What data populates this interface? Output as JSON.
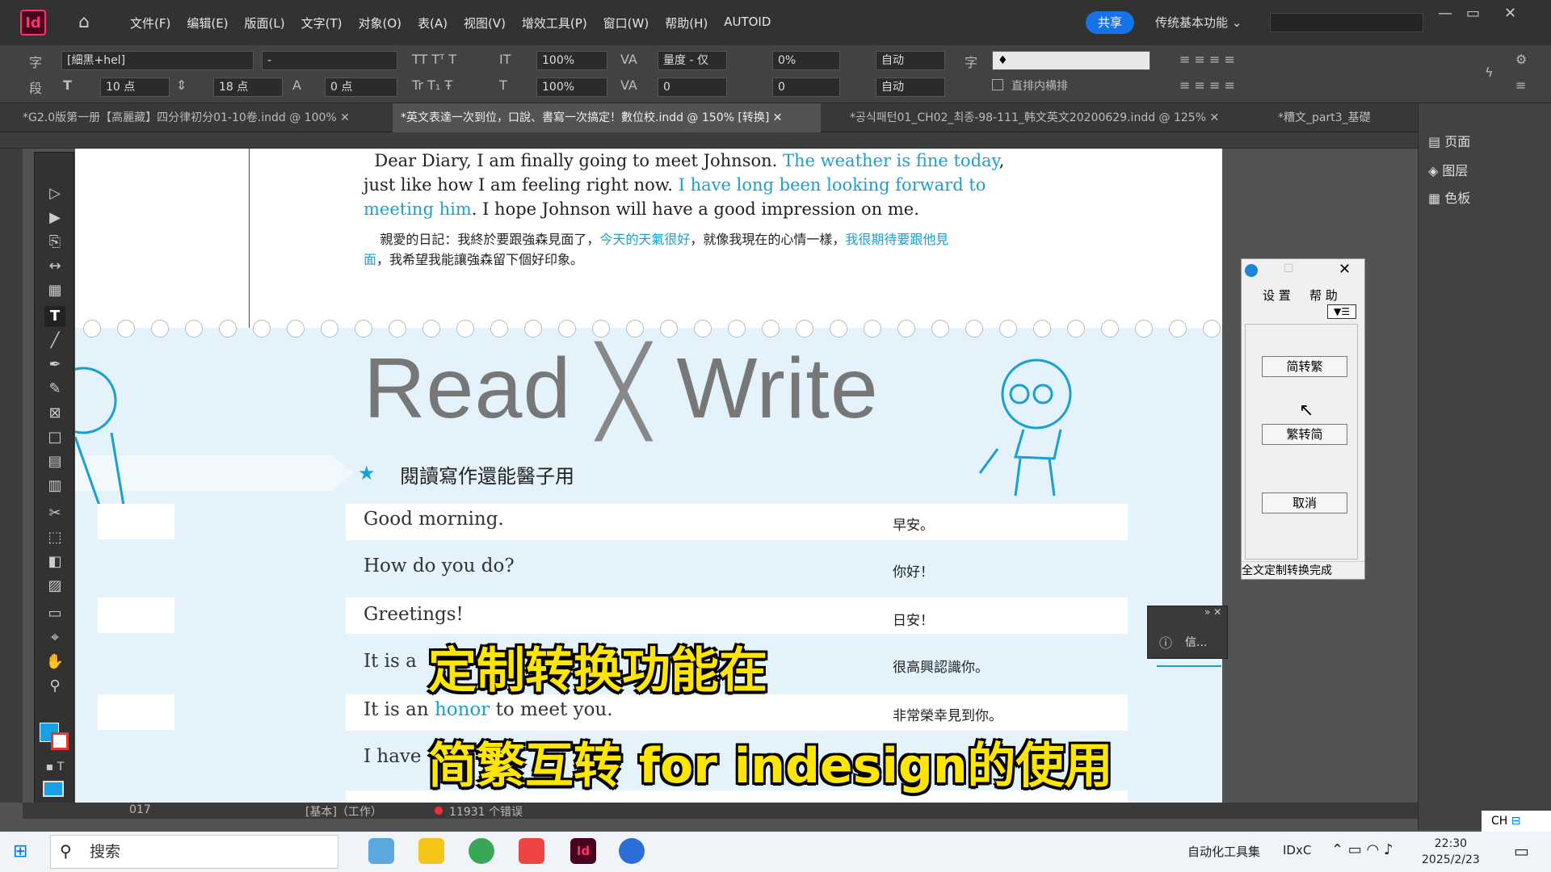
{
  "app": {
    "logo": "Id",
    "menus": [
      "文件(F)",
      "编辑(E)",
      "版面(L)",
      "文字(T)",
      "对象(O)",
      "表(A)",
      "视图(V)",
      "增效工具(P)",
      "窗口(W)",
      "帮助(H)",
      "AUTOID"
    ],
    "share": "共享",
    "workspace": "传统基本功能 ⌄"
  },
  "control": {
    "font": "[細黑+hel]",
    "style": "-",
    "size": "10 点",
    "leading": "18 点",
    "baseline": "0 点",
    "hscale": "100%",
    "vscale": "100%",
    "kerning": "量度 - 仅",
    "tracking": "0",
    "tsume": "0%",
    "tsume2": "0",
    "auto1": "自动",
    "auto2": "自动",
    "char_style": "♦",
    "tate": "直排内横排",
    "char_label": "字",
    "para_label": "段"
  },
  "tabs": [
    "*G2.0版第一册【高麗藏】四分律初分01-10卷.indd @ 100%",
    "*英文表達一次到位，口說、書寫一次搞定！數位校.indd @ 150% [转换]",
    "*공식패턴01_CH02_최종-98-111_韩文英文20200629.indd @ 125%",
    "*糟文_part3_基礎"
  ],
  "right_panel": {
    "pages": "页面",
    "layers": "图层",
    "swatches": "色板"
  },
  "doc": {
    "diary_en": [
      "Dear Diary, I am finally going to meet Johnson.",
      "The weather is fine today",
      ",",
      "just like how I am feeling right now.",
      "I have long been looking forward to",
      "meeting him",
      ". I hope Johnson will have a good impression on me."
    ],
    "diary_zh": [
      "親愛的日記：我終於要跟強森見面了，",
      "今天的天氣很好",
      "，就像我現在的心情一樣，",
      "我很期待要跟他見",
      "面",
      "，我希望我能讓強森留下個好印象。"
    ],
    "read": "Read",
    "write": "Write",
    "star_title": "閱讀寫作還能醫子用",
    "rows": [
      {
        "en": "Good morning.",
        "zh": "早安。"
      },
      {
        "en": "How do you do?",
        "zh": "你好！"
      },
      {
        "en": "Greetings!",
        "zh": "日安！"
      },
      {
        "en": "It is a",
        "zh": "很高興認識你。"
      },
      {
        "en_a": "It is an",
        "en_b": "honor",
        "en_c": "to meet you.",
        "zh": "非常榮幸見到你。"
      },
      {
        "en": "I have",
        "zh": ""
      }
    ]
  },
  "dialog": {
    "menu_settings": "设 置",
    "menu_help": "帮 助",
    "dropdown": "▼☰",
    "btn1": "简转繁",
    "btn2": "繁转简",
    "btn3": "取消",
    "status": "全文定制转换完成"
  },
  "info": "信...",
  "subtitles": {
    "line1": "定制转换功能在",
    "line2": "简繁互转 for indesign的使用"
  },
  "status": {
    "page": "017",
    "mode": "[基本]（工作）",
    "errors": "11931 个错误"
  },
  "taskbar": {
    "search": "搜索",
    "autotool": "自动化工具集",
    "idx": "IDxC",
    "ime": "CH",
    "time": "22:30",
    "date": "2025/2/23"
  }
}
